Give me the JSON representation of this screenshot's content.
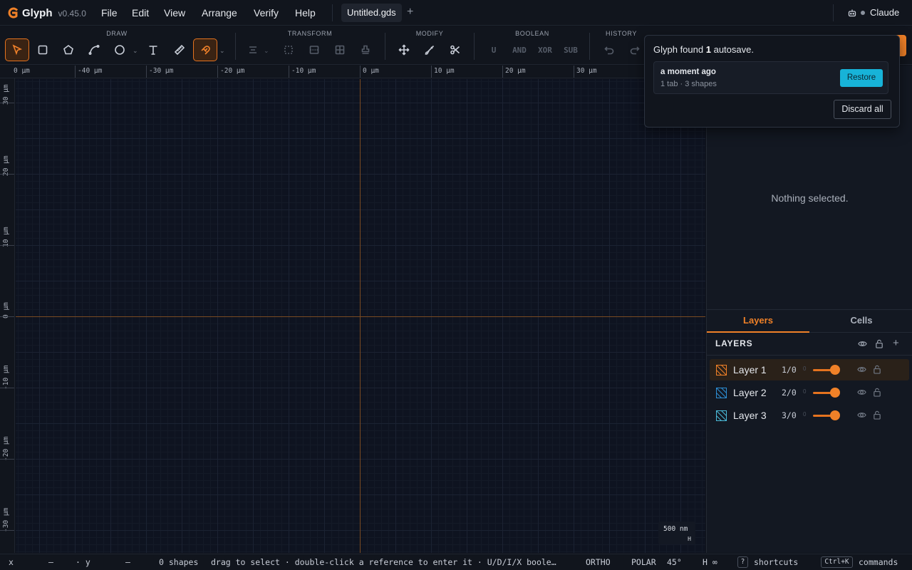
{
  "app": {
    "name": "Glyph",
    "version": "v0.45.0"
  },
  "menu": [
    "File",
    "Edit",
    "View",
    "Arrange",
    "Verify",
    "Help"
  ],
  "file_tab": {
    "name": "Untitled.gds",
    "new_tab": "+"
  },
  "user": {
    "name": "Claude"
  },
  "toolbar": {
    "groups": [
      "DRAW",
      "TRANSFORM",
      "MODIFY",
      "BOOLEAN",
      "HISTORY"
    ],
    "draw_tools": [
      "select-icon",
      "rectangle-icon",
      "polygon-icon",
      "path-icon",
      "circle-icon",
      "text-icon",
      "ruler-icon",
      "snap-magnet-icon"
    ],
    "transform_tools": [
      "align-icon",
      "bounding-box-icon",
      "distribute-icon",
      "array-grid-icon",
      "stamp-icon"
    ],
    "modify_tools": [
      "move-icon",
      "paint-brush-icon",
      "scissors-icon"
    ],
    "boolean_ops": [
      "U",
      "AND",
      "XOR",
      "SUB"
    ],
    "history_tools": [
      "undo-icon",
      "redo-icon"
    ],
    "accent": "#f08128"
  },
  "ruler": {
    "top_labels": [
      "0 µm",
      "-40 µm",
      "-30 µm",
      "-20 µm",
      "-10 µm",
      "0 µm",
      "10 µm",
      "20 µm",
      "30 µm"
    ],
    "left_labels": [
      "30 µm",
      "20 µm",
      "10 µm",
      "0 µm",
      "-10 µm",
      "-20 µm",
      "-30 µm"
    ]
  },
  "canvas": {
    "scale_bar": "500 nm",
    "scale_key": "H"
  },
  "autosave": {
    "message_prefix": "Glyph found",
    "count": "1",
    "message_suffix": "autosave.",
    "time": "a moment ago",
    "detail": "1 tab · 3 shapes",
    "restore": "Restore",
    "discard": "Discard all"
  },
  "panel": {
    "empty_message": "Nothing selected.",
    "tabs": [
      "Layers",
      "Cells"
    ],
    "layers_title": "LAYERS",
    "layers": [
      {
        "name": "Layer 1",
        "code": "1/0",
        "mini": "0",
        "swatch": "#f08128",
        "opacity": 1.0
      },
      {
        "name": "Layer 2",
        "code": "2/0",
        "mini": "0",
        "swatch": "#2d8fd6",
        "opacity": 1.0
      },
      {
        "name": "Layer 3",
        "code": "3/0",
        "mini": "0",
        "swatch": "#4bbbd9",
        "opacity": 1.0
      }
    ]
  },
  "status": {
    "x_label": "x",
    "x_value": "—",
    "y_label": "· y",
    "y_value": "—",
    "shapes": "0 shapes",
    "hint": "drag to select · double-click a reference to enter it · U/D/I/X boole…",
    "ortho": "ORTHO",
    "polar": "POLAR",
    "polar_angle": "45°",
    "h_value": "H ∞",
    "shortcuts_key": "?",
    "shortcuts": "shortcuts",
    "commands_key": "Ctrl+K",
    "commands": "commands"
  }
}
